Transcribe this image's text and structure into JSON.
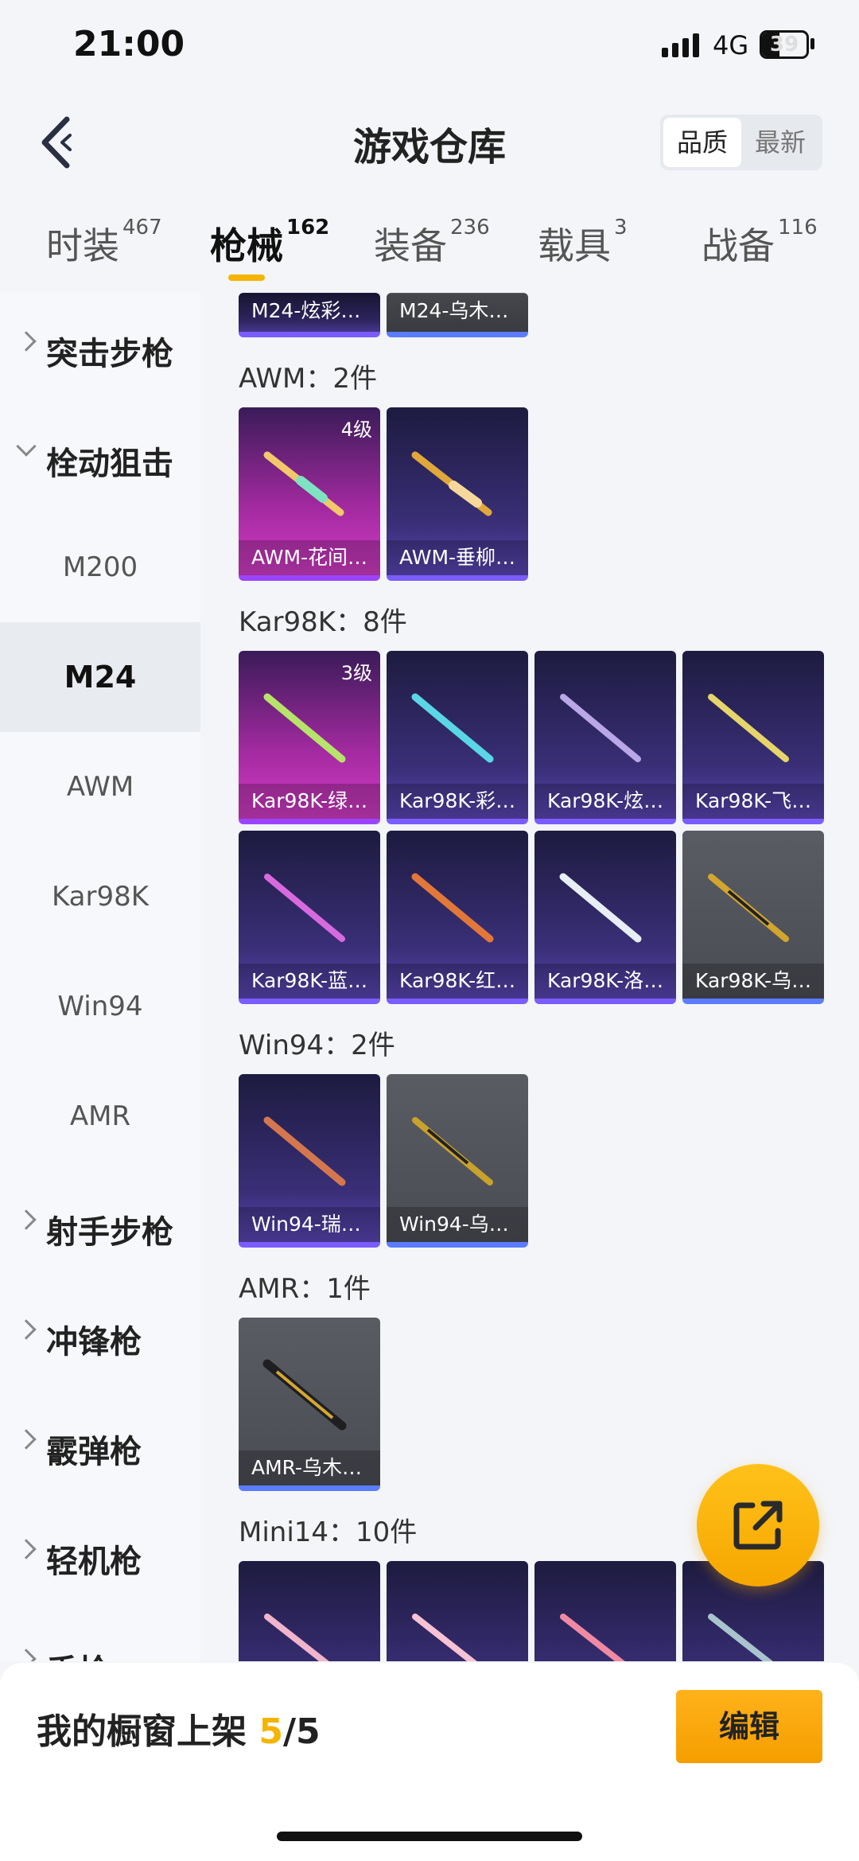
{
  "status_bar": {
    "time": "21:00",
    "network": "4G",
    "battery": "39"
  },
  "header": {
    "title": "游戏仓库",
    "sort_options": [
      "品质",
      "最新"
    ],
    "sort_active": 0
  },
  "tabs": [
    {
      "label": "时装",
      "count": "467"
    },
    {
      "label": "枪械",
      "count": "162"
    },
    {
      "label": "装备",
      "count": "236"
    },
    {
      "label": "载具",
      "count": "3"
    },
    {
      "label": "战备",
      "count": "116"
    }
  ],
  "sidebar": {
    "categories": [
      "突击步枪",
      "栓动狙击",
      "射手步枪",
      "冲锋枪",
      "霰弹枪",
      "轻机枪",
      "手枪"
    ],
    "subitems": [
      "M200",
      "M24",
      "AWM",
      "Kar98K",
      "Win94",
      "AMR"
    ]
  },
  "sections": {
    "m24_partial": [
      "M24-炫彩…",
      "M24-乌木…"
    ],
    "awm": {
      "title": "AWM：2件",
      "items": [
        "AWM-花间…",
        "AWM-垂柳…"
      ],
      "level": "4级"
    },
    "kar98k": {
      "title": "Kar98K：8件",
      "items": [
        "Kar98K-绿…",
        "Kar98K-彩…",
        "Kar98K-炫…",
        "Kar98K-飞…",
        "Kar98K-蓝…",
        "Kar98K-红…",
        "Kar98K-洛…",
        "Kar98K-乌…"
      ],
      "level": "3级"
    },
    "win94": {
      "title": "Win94：2件",
      "items": [
        "Win94-瑞…",
        "Win94-乌…"
      ]
    },
    "amr": {
      "title": "AMR：1件",
      "items": [
        "AMR-乌木…"
      ]
    },
    "mini14": {
      "title": "Mini14：10件"
    }
  },
  "bottom": {
    "label": "我的橱窗上架 ",
    "current": "5",
    "total": "/5",
    "edit_label": "编辑"
  },
  "colors": {
    "accent": "#f5b400",
    "pink_card": "#c535bd",
    "purple_card": "#3a2f78",
    "gray_card": "#54565e"
  }
}
